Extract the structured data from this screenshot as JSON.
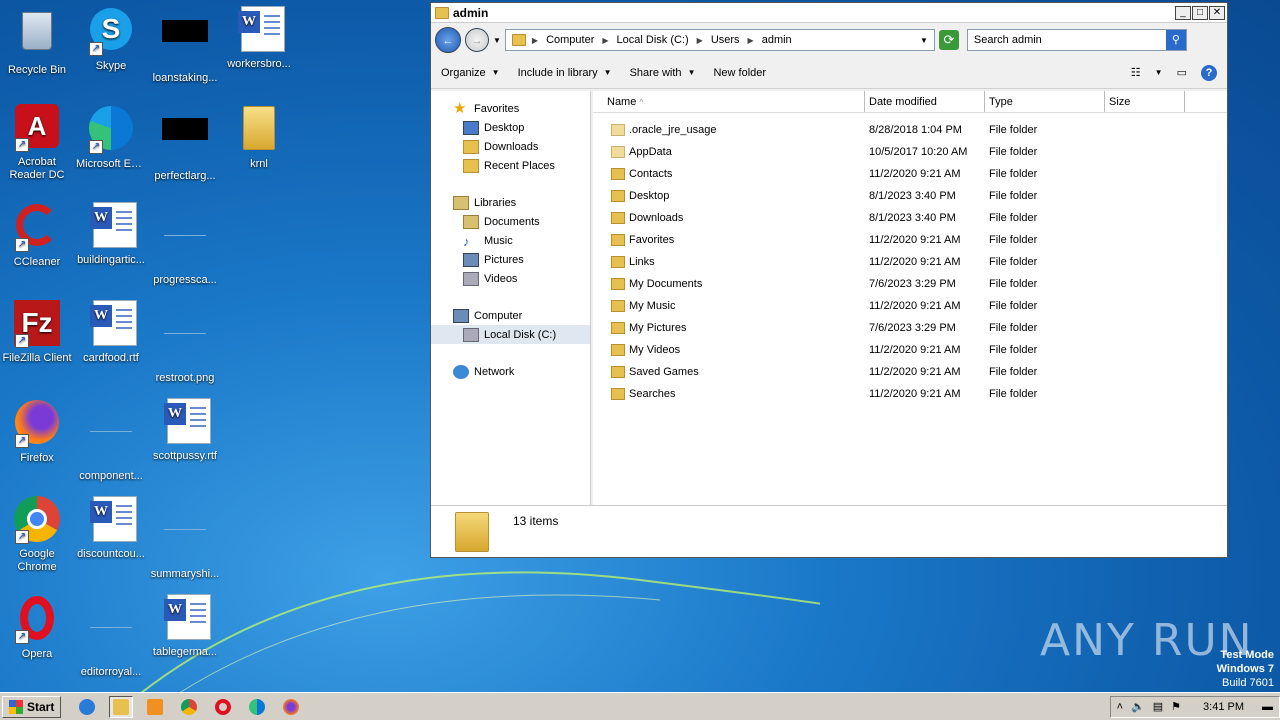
{
  "desktop": {
    "icons": [
      {
        "label": "Recycle Bin"
      },
      {
        "label": "Skype"
      },
      {
        "label": "loanstaking..."
      },
      {
        "label": "workersbro..."
      },
      {
        "label": "Acrobat Reader DC"
      },
      {
        "label": "Microsoft Edge"
      },
      {
        "label": "perfectlarg..."
      },
      {
        "label": "krnl"
      },
      {
        "label": "CCleaner"
      },
      {
        "label": "buildingartic..."
      },
      {
        "label": "progressca..."
      },
      {
        "label": "FileZilla Client"
      },
      {
        "label": "cardfood.rtf"
      },
      {
        "label": "restroot.png"
      },
      {
        "label": "Firefox"
      },
      {
        "label": "component..."
      },
      {
        "label": "scottpussy.rtf"
      },
      {
        "label": "Google Chrome"
      },
      {
        "label": "discountcou..."
      },
      {
        "label": "summaryshi..."
      },
      {
        "label": "Opera"
      },
      {
        "label": "editorroyal..."
      },
      {
        "label": "tablegerma..."
      }
    ]
  },
  "window": {
    "title": "admin",
    "controls": {
      "minimize": "_",
      "maximize": "□",
      "close": "✕"
    },
    "breadcrumb": [
      "Computer",
      "Local Disk (C:)",
      "Users",
      "admin"
    ],
    "search_placeholder": "Search admin",
    "toolbar": {
      "organize": "Organize",
      "include": "Include in library",
      "share": "Share with",
      "new_folder": "New folder"
    },
    "nav": {
      "favorites": "Favorites",
      "desktop": "Desktop",
      "downloads": "Downloads",
      "recent": "Recent Places",
      "libraries": "Libraries",
      "documents": "Documents",
      "music": "Music",
      "pictures": "Pictures",
      "videos": "Videos",
      "computer": "Computer",
      "local_disk": "Local Disk (C:)",
      "network": "Network"
    },
    "columns": {
      "name": "Name",
      "date": "Date modified",
      "type": "Type",
      "size": "Size"
    },
    "files": [
      {
        "name": ".oracle_jre_usage",
        "date": "8/28/2018 1:04 PM",
        "type": "File folder"
      },
      {
        "name": "AppData",
        "date": "10/5/2017 10:20 AM",
        "type": "File folder"
      },
      {
        "name": "Contacts",
        "date": "11/2/2020 9:21 AM",
        "type": "File folder"
      },
      {
        "name": "Desktop",
        "date": "8/1/2023 3:40 PM",
        "type": "File folder"
      },
      {
        "name": "Downloads",
        "date": "8/1/2023 3:40 PM",
        "type": "File folder"
      },
      {
        "name": "Favorites",
        "date": "11/2/2020 9:21 AM",
        "type": "File folder"
      },
      {
        "name": "Links",
        "date": "11/2/2020 9:21 AM",
        "type": "File folder"
      },
      {
        "name": "My Documents",
        "date": "7/6/2023 3:29 PM",
        "type": "File folder"
      },
      {
        "name": "My Music",
        "date": "11/2/2020 9:21 AM",
        "type": "File folder"
      },
      {
        "name": "My Pictures",
        "date": "7/6/2023 3:29 PM",
        "type": "File folder"
      },
      {
        "name": "My Videos",
        "date": "11/2/2020 9:21 AM",
        "type": "File folder"
      },
      {
        "name": "Saved Games",
        "date": "11/2/2020 9:21 AM",
        "type": "File folder"
      },
      {
        "name": "Searches",
        "date": "11/2/2020 9:21 AM",
        "type": "File folder"
      }
    ],
    "item_count": "13 items"
  },
  "taskbar": {
    "start_label": "Start",
    "clock": "3:41 PM"
  },
  "watermark": "ANY RUN",
  "test_mode": {
    "line1": "Test Mode",
    "line2": "Windows 7",
    "line3": "Build 7601"
  }
}
